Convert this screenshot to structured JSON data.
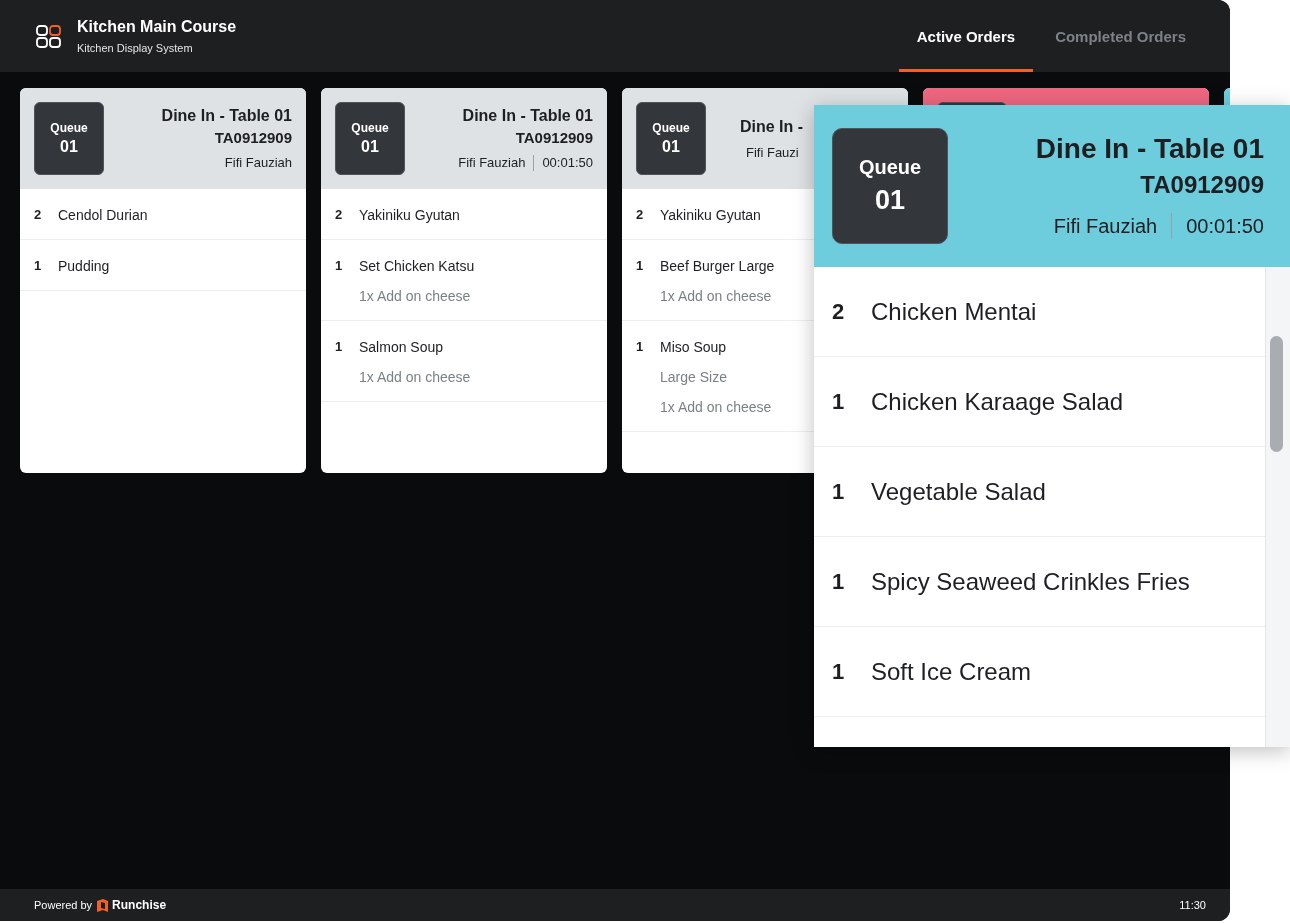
{
  "header": {
    "title": "Kitchen Main Course",
    "subtitle": "Kitchen Display System"
  },
  "tabs": [
    {
      "label": "Active Orders",
      "selected": true
    },
    {
      "label": "Completed Orders",
      "selected": false
    }
  ],
  "orders": [
    {
      "color": "#dfe2e5",
      "covered": false,
      "queue_label": "Queue",
      "queue_number": "01",
      "title": "Dine In - Table 01",
      "order_id": "TA0912909",
      "customer": "Fifi Fauziah",
      "items": [
        {
          "qty": "2",
          "name": "Cendol Durian"
        },
        {
          "qty": "1",
          "name": "Pudding"
        }
      ]
    },
    {
      "color": "#dfe2e5",
      "covered": false,
      "queue_label": "Queue",
      "queue_number": "01",
      "title": "Dine In - Table 01",
      "order_id": "TA0912909",
      "customer": "Fifi Fauziah",
      "elapsed": "00:01:50",
      "items": [
        {
          "qty": "2",
          "name": "Yakiniku Gyutan"
        },
        {
          "qty": "1",
          "name": "Set Chicken Katsu",
          "notes": [
            "1x Add on cheese"
          ]
        },
        {
          "qty": "1",
          "name": "Salmon Soup",
          "notes": [
            "1x Add on cheese"
          ]
        }
      ]
    },
    {
      "color": "#dfe2e5",
      "covered": true,
      "queue_label": "Queue",
      "queue_number": "01",
      "title": "Dine In -",
      "customer": "Fifi Fauzi",
      "items": [
        {
          "qty": "2",
          "name": "Yakiniku Gyutan"
        },
        {
          "qty": "1",
          "name": "Beef Burger Large",
          "notes": [
            "1x Add on cheese"
          ]
        },
        {
          "qty": "1",
          "name": "Miso Soup",
          "notes": [
            "Large Size",
            "1x Add on cheese"
          ]
        }
      ]
    },
    {
      "color": "#ef6680",
      "badge": true
    },
    {
      "color": "#6ecddd"
    }
  ],
  "detail": {
    "color": "#6ecddd",
    "queue_label": "Queue",
    "queue_number": "01",
    "title": "Dine In - Table 01",
    "order_id": "TA0912909",
    "customer": "Fifi Fauziah",
    "elapsed": "00:01:50",
    "items": [
      {
        "qty": "2",
        "name": "Chicken Mentai"
      },
      {
        "qty": "1",
        "name": "Chicken Karaage Salad"
      },
      {
        "qty": "1",
        "name": "Vegetable Salad"
      },
      {
        "qty": "1",
        "name": "Spicy Seaweed Crinkles Fries"
      },
      {
        "qty": "1",
        "name": "Soft Ice Cream"
      }
    ]
  },
  "footer": {
    "powered_by": "Powered by",
    "brand": "Runchise",
    "time": "11:30"
  }
}
